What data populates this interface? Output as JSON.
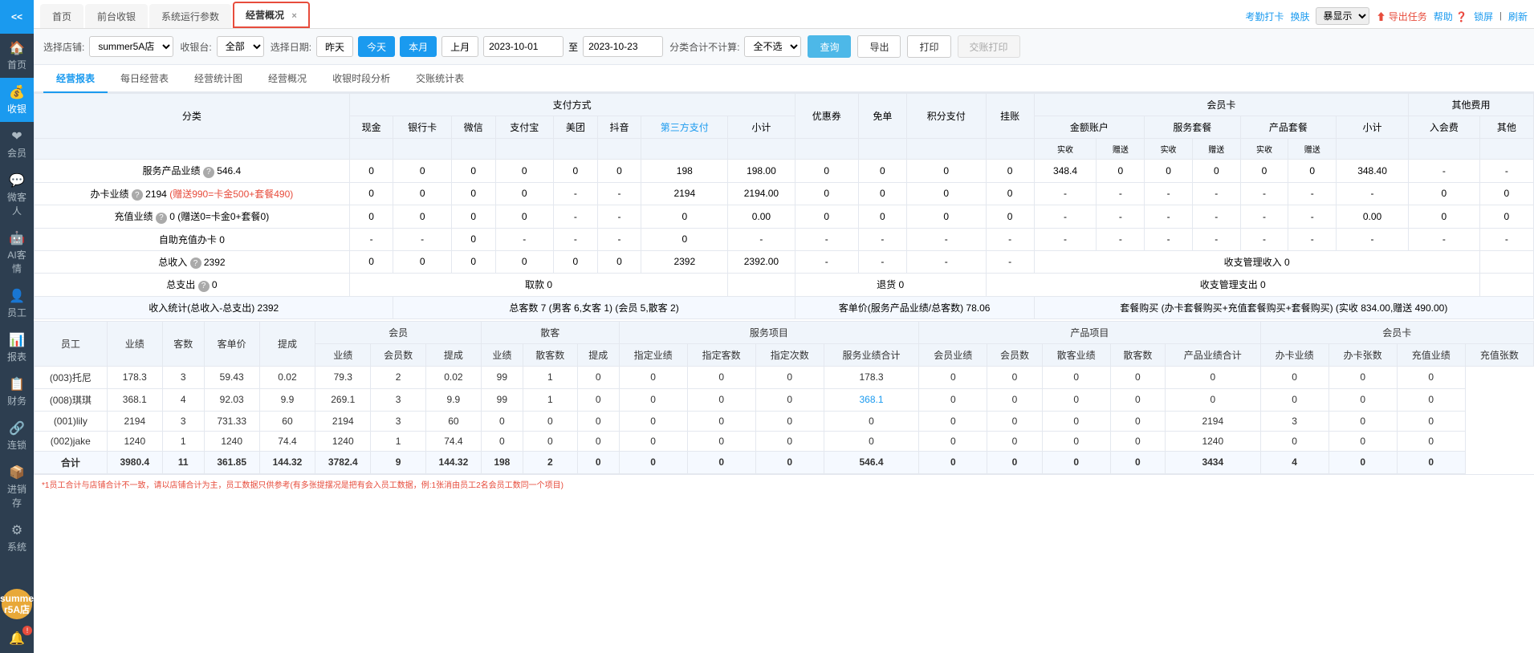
{
  "sidebar": {
    "logo": "<<",
    "items": [
      {
        "id": "home",
        "icon": "🏠",
        "label": "首页"
      },
      {
        "id": "cashier",
        "icon": "💰",
        "label": "收银"
      },
      {
        "id": "member",
        "icon": "❤",
        "label": "会员"
      },
      {
        "id": "wechat",
        "icon": "💬",
        "label": "微客人"
      },
      {
        "id": "ai",
        "icon": "🤖",
        "label": "AI客情"
      },
      {
        "id": "staff",
        "icon": "👤",
        "label": "员工"
      },
      {
        "id": "report",
        "icon": "📊",
        "label": "报表"
      },
      {
        "id": "finance",
        "icon": "📋",
        "label": "财务"
      },
      {
        "id": "chain",
        "icon": "🔗",
        "label": "连锁"
      },
      {
        "id": "inventory",
        "icon": "📦",
        "label": "进销存"
      },
      {
        "id": "system",
        "icon": "⚙",
        "label": "系统"
      }
    ],
    "user": "summe\nr5A店",
    "alert_icon": "🔔"
  },
  "top_nav": {
    "tabs": [
      {
        "id": "home",
        "label": "首页",
        "closable": false
      },
      {
        "id": "cashier",
        "label": "前台收银",
        "closable": false
      },
      {
        "id": "sysparams",
        "label": "系统运行参数",
        "closable": false
      },
      {
        "id": "bizview",
        "label": "经营概况",
        "closable": true,
        "active": true,
        "highlighted": true
      }
    ],
    "right_actions": [
      {
        "id": "attendance",
        "label": "考勤打卡",
        "type": "link"
      },
      {
        "id": "skin",
        "label": "换肤",
        "type": "link"
      },
      {
        "id": "skin_select",
        "value": "暴显示",
        "type": "select"
      },
      {
        "id": "export_task",
        "label": "导出任务",
        "type": "export"
      },
      {
        "id": "help",
        "label": "帮助",
        "type": "link"
      },
      {
        "id": "lock",
        "label": "锁屏",
        "type": "link"
      },
      {
        "id": "refresh",
        "label": "刷新",
        "type": "link"
      }
    ]
  },
  "toolbar": {
    "store_label": "选择店铺:",
    "store_value": "summer5A店",
    "cashier_label": "收银台:",
    "cashier_value": "全部",
    "date_label": "选择日期:",
    "date_buttons": [
      {
        "label": "昨天",
        "active": false
      },
      {
        "label": "今天",
        "active": false
      },
      {
        "label": "本月",
        "active": true
      },
      {
        "label": "上月",
        "active": false
      }
    ],
    "date_from": "2023-10-01",
    "date_to": "2023-10-23",
    "category_label": "分类合计不计算:",
    "category_value": "全不选",
    "query_btn": "查询",
    "export_btn": "导出",
    "print_btn": "打印",
    "exchange_print_btn": "交账打印"
  },
  "sub_tabs": [
    {
      "id": "report",
      "label": "经营报表",
      "active": true
    },
    {
      "id": "daily",
      "label": "每日经营表"
    },
    {
      "id": "chart",
      "label": "经营统计图"
    },
    {
      "id": "overview",
      "label": "经营概况"
    },
    {
      "id": "cashier_analysis",
      "label": "收银时段分析"
    },
    {
      "id": "exchange_stats",
      "label": "交账统计表"
    }
  ],
  "main_table": {
    "header_groups": [
      {
        "label": "分类",
        "colspan": 1,
        "rowspan": 2
      },
      {
        "label": "支付方式",
        "colspan": 8
      },
      {
        "label": "优惠券",
        "colspan": 1,
        "rowspan": 2
      },
      {
        "label": "免单",
        "colspan": 1,
        "rowspan": 2
      },
      {
        "label": "积分支付",
        "colspan": 1,
        "rowspan": 2
      },
      {
        "label": "挂账",
        "colspan": 1,
        "rowspan": 2
      },
      {
        "label": "会员卡",
        "colspan": 6
      },
      {
        "label": "其他费用",
        "colspan": 3
      }
    ],
    "payment_headers": [
      "现金",
      "银行卡",
      "微信",
      "支付宝",
      "美团",
      "抖音",
      "第三方支付",
      "小计"
    ],
    "member_headers": [
      "金额账户",
      "",
      "服务套餐",
      "",
      "产品套餐",
      ""
    ],
    "member_sub_headers": [
      "实收",
      "赠送",
      "实收",
      "赠送",
      "实收",
      "赠送"
    ],
    "member_subtotal": "小计",
    "other_headers": [
      "入会费",
      "其他"
    ],
    "rows": [
      {
        "label": "服务产品业绩 ❓ 546.4",
        "values": [
          "0",
          "0",
          "0",
          "0",
          "0",
          "0",
          "198",
          "198.00",
          "0",
          "0",
          "0",
          "0",
          "348.4",
          "0",
          "0",
          "0",
          "0",
          "348.40",
          "-",
          "-"
        ]
      },
      {
        "label": "办卡业绩 ❓ 2194 (赠送990=卡金500+套餐490)",
        "values": [
          "0",
          "0",
          "0",
          "0",
          "-",
          "-",
          "2194",
          "2194.00",
          "0",
          "0",
          "0",
          "0",
          "-",
          "-",
          "-",
          "-",
          "-",
          "-",
          "0",
          "0"
        ],
        "highlighted": true
      },
      {
        "label": "充值业绩 ❓ 0 (赠送0=卡金0+套餐0)",
        "values": [
          "0",
          "0",
          "0",
          "0",
          "-",
          "-",
          "0",
          "0.00",
          "0",
          "0",
          "0",
          "0",
          "-",
          "-",
          "-",
          "-",
          "-",
          "0.00",
          "0",
          "0"
        ]
      },
      {
        "label": "自助充值办卡 0",
        "values": [
          "-",
          "-",
          "0",
          "-",
          "-",
          "-",
          "0",
          "-",
          "-",
          "-",
          "-",
          "-",
          "-",
          "-",
          "-",
          "-",
          "-",
          "-",
          "-",
          "-"
        ]
      },
      {
        "label": "总收入 ❓ 2392",
        "values": [
          "0",
          "0",
          "0",
          "0",
          "0",
          "0",
          "2392",
          "2392.00",
          "-",
          "-",
          "-",
          "-",
          "收支管理收入 0",
          "",
          "",
          "",
          "",
          "",
          "",
          ""
        ]
      },
      {
        "label": "总支出 ❓ 0",
        "values": [
          "取款 0",
          "",
          "",
          "",
          "",
          "",
          "",
          "",
          "退货 0",
          "",
          "",
          "",
          "收支管理支出 0",
          "",
          "",
          "",
          "",
          "",
          "",
          ""
        ]
      },
      {
        "label": "收入统计(总收入-总支出) 2392",
        "values": [
          "总客数 7 (男客 6,女客 1) (会员 5,散客 2)",
          "",
          "",
          "",
          "",
          "",
          "",
          "",
          "客单价(服务产品业绩/总客数) 78.06",
          "",
          "",
          "",
          "套餐购买 (办卡套餐购买+充值套餐购买+套餐购买)  (实收 834.00,赠送 490.00)",
          "",
          "",
          "",
          "",
          "",
          "",
          ""
        ]
      }
    ]
  },
  "employee_table": {
    "header_groups": [
      {
        "label": "员工",
        "rowspan": 2
      },
      {
        "label": "业绩",
        "rowspan": 2
      },
      {
        "label": "客数",
        "rowspan": 2
      },
      {
        "label": "客单价",
        "rowspan": 2
      },
      {
        "label": "提成",
        "rowspan": 2
      },
      {
        "label": "会员",
        "colspan": 3
      },
      {
        "label": "散客",
        "colspan": 3
      },
      {
        "label": "服务项目",
        "colspan": 4
      },
      {
        "label": "产品项目",
        "colspan": 3
      },
      {
        "label": "会员卡",
        "colspan": 4
      }
    ],
    "sub_headers": [
      "业绩",
      "会员数",
      "提成",
      "业绩",
      "散客数",
      "提成",
      "指定业绩",
      "指定客数",
      "指定次数",
      "服务业绩合计",
      "会员业绩",
      "会员数",
      "散客业绩",
      "散客数",
      "产品业绩合计",
      "办卡业绩",
      "办卡张数",
      "充值业绩",
      "充值张数"
    ],
    "rows": [
      {
        "name": "(003)托尼",
        "values": [
          "178.3",
          "3",
          "59.43",
          "0.02",
          "79.3",
          "2",
          "0.02",
          "99",
          "1",
          "0",
          "0",
          "0",
          "178.3",
          "0",
          "0",
          "0",
          "0",
          "0",
          "0",
          "0",
          "0",
          "0"
        ]
      },
      {
        "name": "(008)琪琪",
        "values": [
          "368.1",
          "4",
          "92.03",
          "9.9",
          "269.1",
          "3",
          "9.9",
          "99",
          "1",
          "0",
          "0",
          "0",
          "368.1",
          "0",
          "0",
          "0",
          "0",
          "0",
          "0",
          "0",
          "0",
          "0"
        ],
        "highlight_cell": 12
      },
      {
        "name": "(001)lily",
        "values": [
          "2194",
          "3",
          "731.33",
          "60",
          "2194",
          "3",
          "60",
          "0",
          "0",
          "0",
          "0",
          "0",
          "0",
          "0",
          "0",
          "0",
          "0",
          "2194",
          "3",
          "0",
          "0",
          "0"
        ]
      },
      {
        "name": "(002)jake",
        "values": [
          "1240",
          "1",
          "1240",
          "74.4",
          "1240",
          "1",
          "74.4",
          "0",
          "0",
          "0",
          "0",
          "0",
          "0",
          "0",
          "0",
          "0",
          "0",
          "1240",
          "0",
          "0",
          "0",
          "0"
        ]
      }
    ],
    "total_row": {
      "label": "合计",
      "values": [
        "3980.4",
        "11",
        "361.85",
        "144.32",
        "3782.4",
        "9",
        "144.32",
        "198",
        "2",
        "0",
        "0",
        "0",
        "546.4",
        "0",
        "0",
        "0",
        "0",
        "3434",
        "4",
        "0",
        "0",
        "0"
      ]
    }
  },
  "footer_note": "*1员工合计与店铺合计不一致，请以店铺合计为主，员工数据只供参考(有多张提摆况是把有会入员工数据，例:1张消由员工2名会员工数同一个项目)",
  "colors": {
    "primary": "#1a9aef",
    "sidebar_bg": "#2d3e50",
    "header_bg": "#f0f5fb",
    "border": "#e4e8ef",
    "red": "#e74c3c"
  }
}
